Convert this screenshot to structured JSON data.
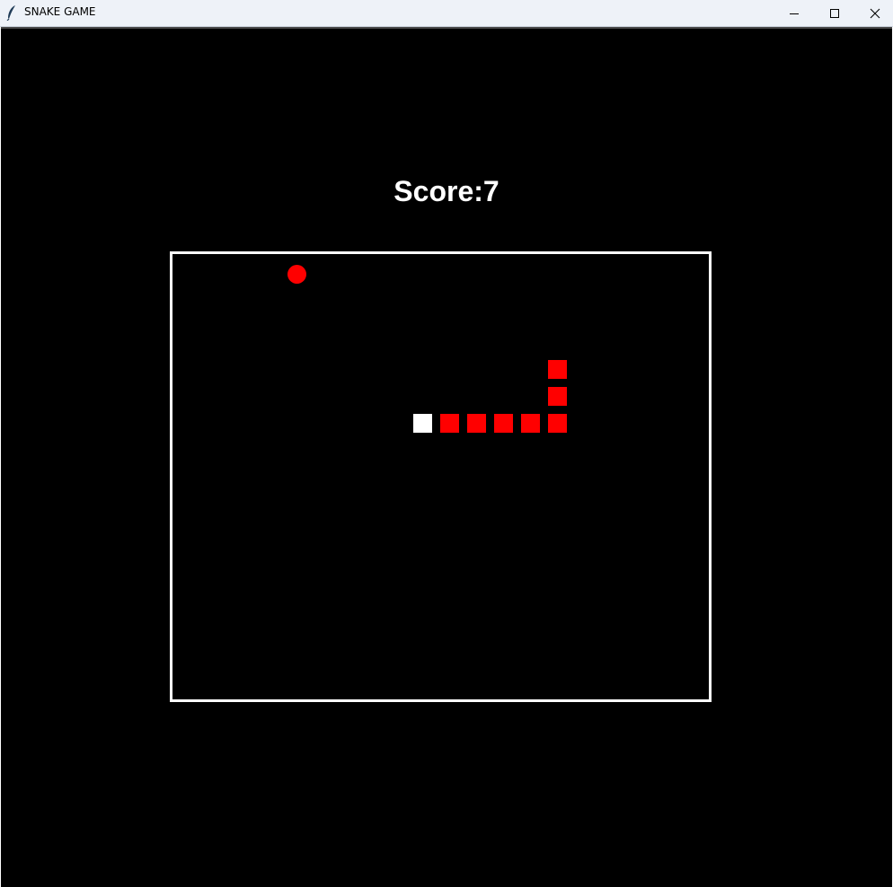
{
  "window": {
    "title": "SNAKE GAME",
    "app_icon": "feather-icon",
    "controls": [
      "minimize-icon",
      "maximize-icon",
      "close-icon"
    ]
  },
  "game": {
    "score_text": "Score:7",
    "colors": {
      "background": "#000000",
      "border": "#ffffff",
      "snake_head": "#ffffff",
      "snake_body": "#ff0000",
      "food": "#ff0000"
    }
  }
}
